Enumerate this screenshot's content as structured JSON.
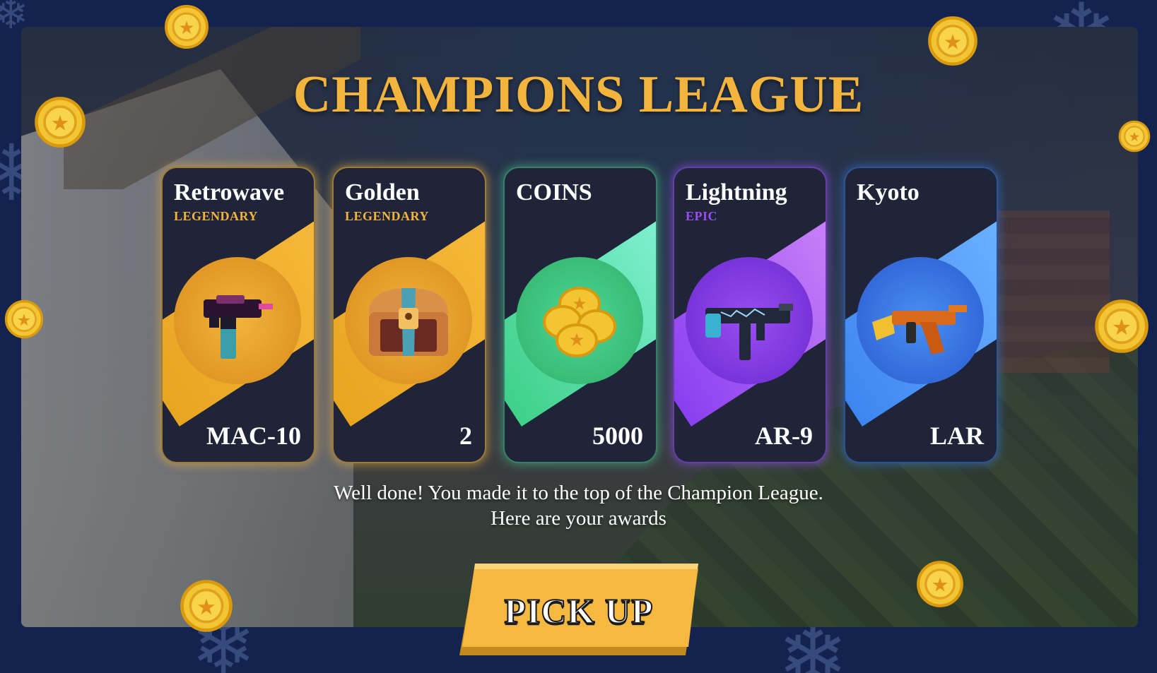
{
  "screen": {
    "title": "CHAMPIONS LEAGUE",
    "message_line1": "Well done! You made it to the top of the Champion League.",
    "message_line2": "Here are your awards",
    "pickup_label": "PICK UP"
  },
  "colors": {
    "legendary": "#f2b43c",
    "epic": "#9a4df0",
    "coins": "#3fd08a",
    "rare": "#3d86f0",
    "card_bg": "#1f2438"
  },
  "rewards": [
    {
      "name": "Retrowave",
      "rarity": "LEGENDARY",
      "value": "MAC-10",
      "icon": "smg-mac10-icon"
    },
    {
      "name": "Golden",
      "rarity": "LEGENDARY",
      "value": "2",
      "icon": "treasure-chest-icon"
    },
    {
      "name": "COINS",
      "rarity": "",
      "value": "5000",
      "icon": "coin-stack-icon"
    },
    {
      "name": "Lightning",
      "rarity": "EPIC",
      "value": "AR-9",
      "icon": "rifle-ar9-icon"
    },
    {
      "name": "Kyoto",
      "rarity": "",
      "value": "LAR",
      "icon": "rifle-lar-icon"
    }
  ]
}
